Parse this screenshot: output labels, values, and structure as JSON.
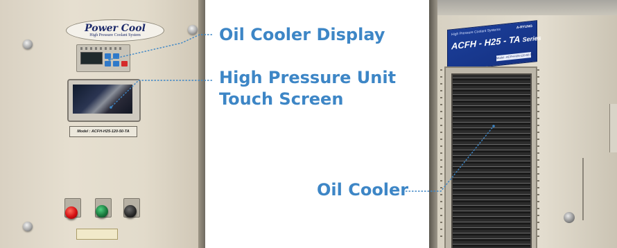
{
  "accent_color": "#3d86c6",
  "annotations": {
    "oil_cooler_display": "Oil Cooler Display",
    "touch_screen_line1": "High Pressure Unit",
    "touch_screen_line2": "Touch Screen",
    "oil_cooler": "Oil Cooler"
  },
  "left_photo": {
    "logo_title": "Power Cool",
    "logo_subtitle": "High Pressure Coolant System",
    "model_plate": "Model : ACFH-H25-120-50-TA",
    "button_colors": [
      "red",
      "green",
      "black"
    ]
  },
  "right_photo": {
    "sign_top": "High Pressure Coolant Systems",
    "sign_brand": "A-RYUNG",
    "sign_series_main": "ACFH - H25 - TA",
    "sign_series_suffix": "Series",
    "sign_model": "Model : ACFH-H25-120-50-TA"
  }
}
